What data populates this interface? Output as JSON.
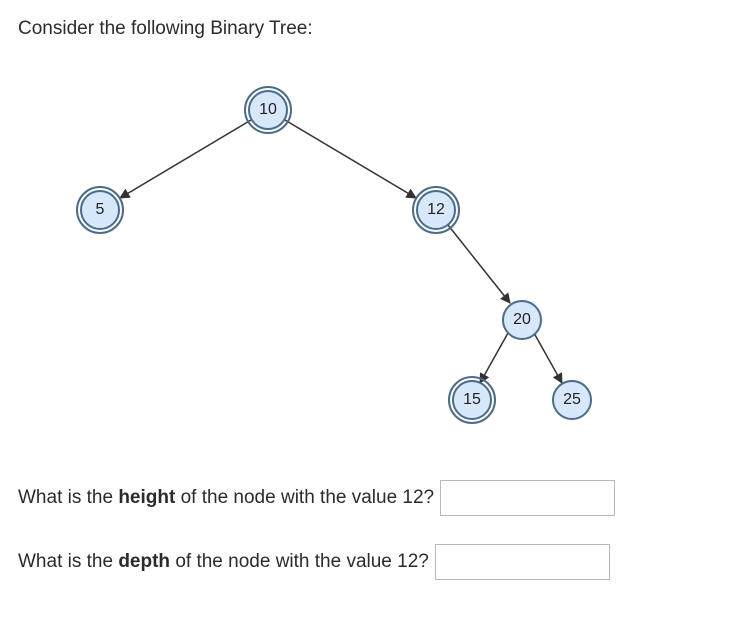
{
  "prompt": "Consider the following Binary Tree:",
  "tree": {
    "nodes": {
      "root": "10",
      "left": "5",
      "right": "12",
      "rr": "20",
      "rrl": "15",
      "rrr": "25"
    }
  },
  "questions": {
    "q1_pre": "What is the ",
    "q1_bold": "height",
    "q1_post": " of the node with the value 12?",
    "q2_pre": "What is the ",
    "q2_bold": "depth",
    "q2_post": " of the node with the value 12?"
  },
  "answers": {
    "q1": "",
    "q2": ""
  }
}
